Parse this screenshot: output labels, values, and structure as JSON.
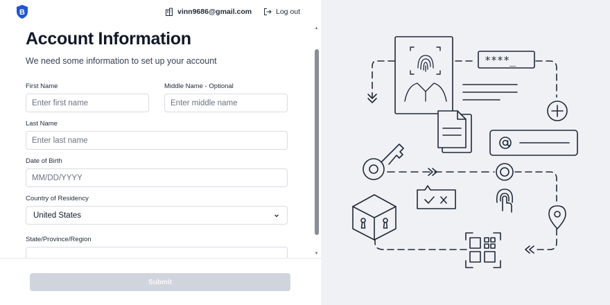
{
  "header": {
    "email": "vinn9686@gmail.com",
    "logout_label": "Log out"
  },
  "form": {
    "title": "Account Information",
    "subtitle": "We need some information to set up your account",
    "first_name": {
      "label": "First Name",
      "placeholder": "Enter first name"
    },
    "middle_name": {
      "label": "Middle Name - Optional",
      "placeholder": "Enter middle name"
    },
    "last_name": {
      "label": "Last Name",
      "placeholder": "Enter last name"
    },
    "dob": {
      "label": "Date of Birth",
      "placeholder": "MM/DD/YYYY"
    },
    "country": {
      "label": "Country of Residency",
      "value": "United States"
    },
    "state": {
      "label": "State/Province/Region",
      "value": ""
    }
  },
  "footer": {
    "submit_label": "Submit"
  },
  "illustration": {
    "password_mask": "****_"
  },
  "colors": {
    "brand": "#1d56d6",
    "submit_disabled": "#d0d4dc",
    "panel_bg": "#f0f1f5",
    "line": "#1f2937"
  }
}
